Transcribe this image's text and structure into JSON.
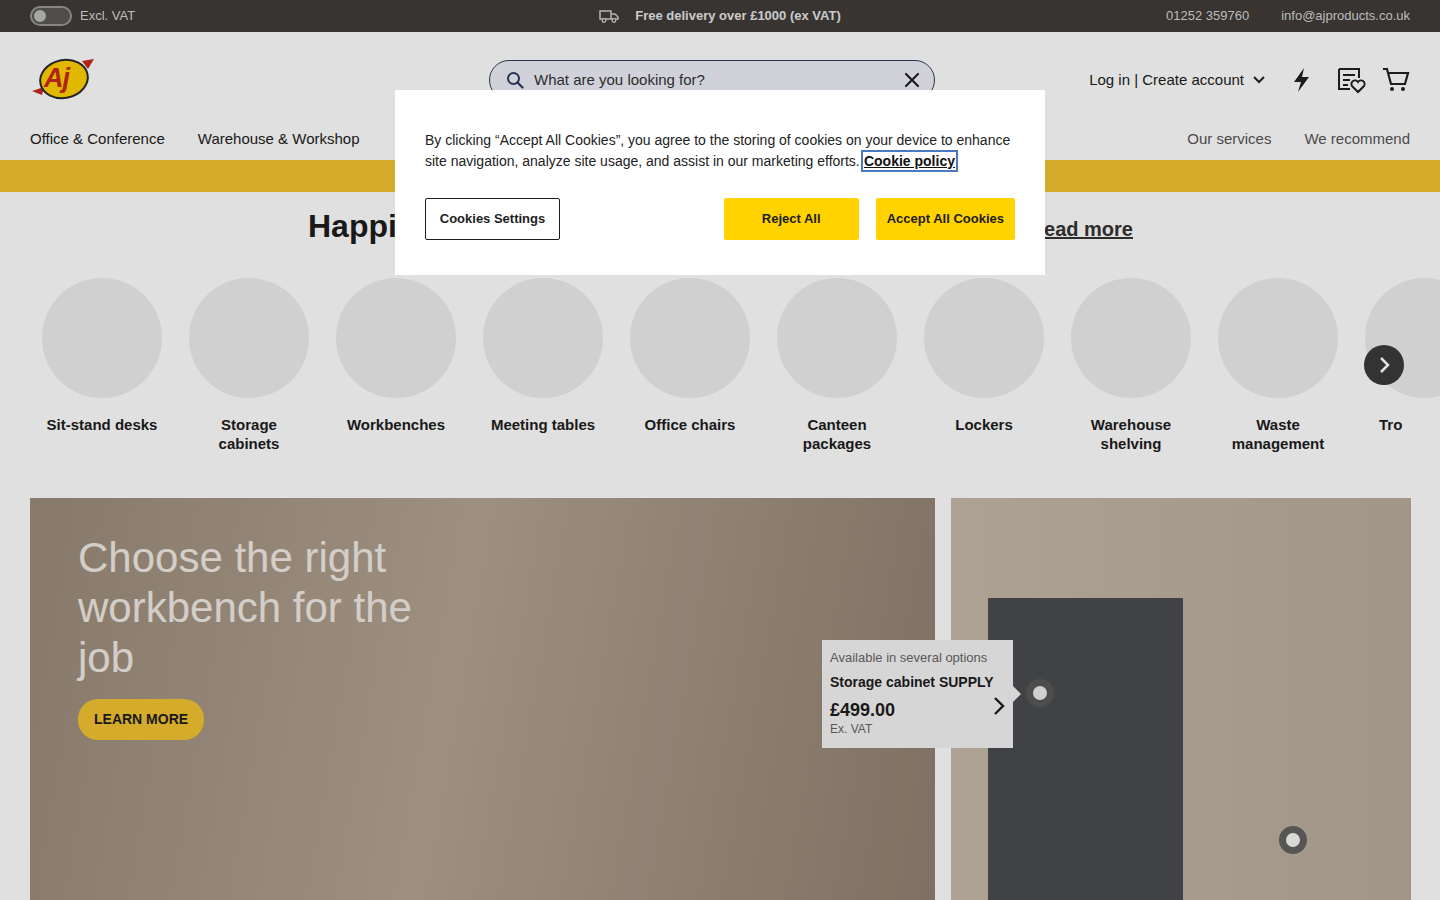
{
  "top_bar": {
    "vat_toggle": {
      "label": "Excl. VAT",
      "on": false
    },
    "delivery": "Free delivery over £1000 (ex VAT)",
    "phone": "01252 359760",
    "email": "info@ajproducts.co.uk"
  },
  "header": {
    "logo": "Aj",
    "search": {
      "placeholder": "What are you looking for?"
    },
    "account": "Log in | Create account"
  },
  "nav": {
    "items": [
      "Office & Conference",
      "Warehouse & Workshop"
    ],
    "secondary": [
      "Our services",
      "We recommend"
    ]
  },
  "banner": {
    "heading": "Happi",
    "link": "ead more"
  },
  "categories": [
    {
      "label": "Sit-stand desks"
    },
    {
      "label": "Storage cabinets"
    },
    {
      "label": "Workbenches"
    },
    {
      "label": "Meeting tables"
    },
    {
      "label": "Office chairs"
    },
    {
      "label": "Canteen packages"
    },
    {
      "label": "Lockers"
    },
    {
      "label": "Warehouse shelving"
    },
    {
      "label": "Waste management"
    },
    {
      "label": "Tro"
    }
  ],
  "promos": {
    "workbench": {
      "title": "Choose the right workbench for the job",
      "button": "LEARN MORE"
    },
    "product_tooltip": {
      "subtitle": "Available in several options",
      "name": "Storage cabinet SUPPLY",
      "price": "£499.00",
      "vat": "Ex. VAT"
    }
  },
  "cookie_dialog": {
    "text": "By clicking “Accept All Cookies”, you agree to the storing of cookies on your device to enhance site navigation, analyze site usage, and assist in our marketing efforts.",
    "link": "Cookie policy",
    "buttons": [
      {
        "label": "Cookies Settings",
        "kind": "outline"
      },
      {
        "label": "Reject All",
        "kind": "filled"
      },
      {
        "label": "Accept All Cookies",
        "kind": "filled"
      }
    ]
  }
}
